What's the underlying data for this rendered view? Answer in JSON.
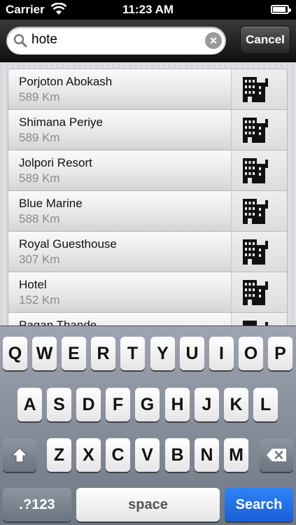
{
  "status_bar": {
    "carrier": "Carrier",
    "time": "11:23 AM",
    "wifi_icon": "wifi-icon",
    "battery_icon": "battery-icon"
  },
  "search": {
    "query": "hote",
    "cancel_label": "Cancel",
    "search_icon": "magnifier-icon",
    "clear_icon": "clear-icon"
  },
  "results": [
    {
      "name": "Porjoton Abokash",
      "distance": "589 Km"
    },
    {
      "name": "Shimana Periye",
      "distance": "589 Km"
    },
    {
      "name": "Jolpori Resort",
      "distance": "589 Km"
    },
    {
      "name": "Blue Marine",
      "distance": "588 Km"
    },
    {
      "name": "Royal Guesthouse",
      "distance": "307 Km"
    },
    {
      "name": "Hotel",
      "distance": "152 Km"
    },
    {
      "name": "Pagan Thande",
      "distance": ""
    }
  ],
  "keyboard": {
    "row1": [
      "Q",
      "W",
      "E",
      "R",
      "T",
      "Y",
      "U",
      "I",
      "O",
      "P"
    ],
    "row2": [
      "A",
      "S",
      "D",
      "F",
      "G",
      "H",
      "J",
      "K",
      "L"
    ],
    "row3": [
      "Z",
      "X",
      "C",
      "V",
      "B",
      "N",
      "M"
    ],
    "numbers_label": ".?123",
    "space_label": "space",
    "search_label": "Search"
  },
  "colors": {
    "search_key": "#2f83f5",
    "keyboard_bg": "#8a929e"
  }
}
